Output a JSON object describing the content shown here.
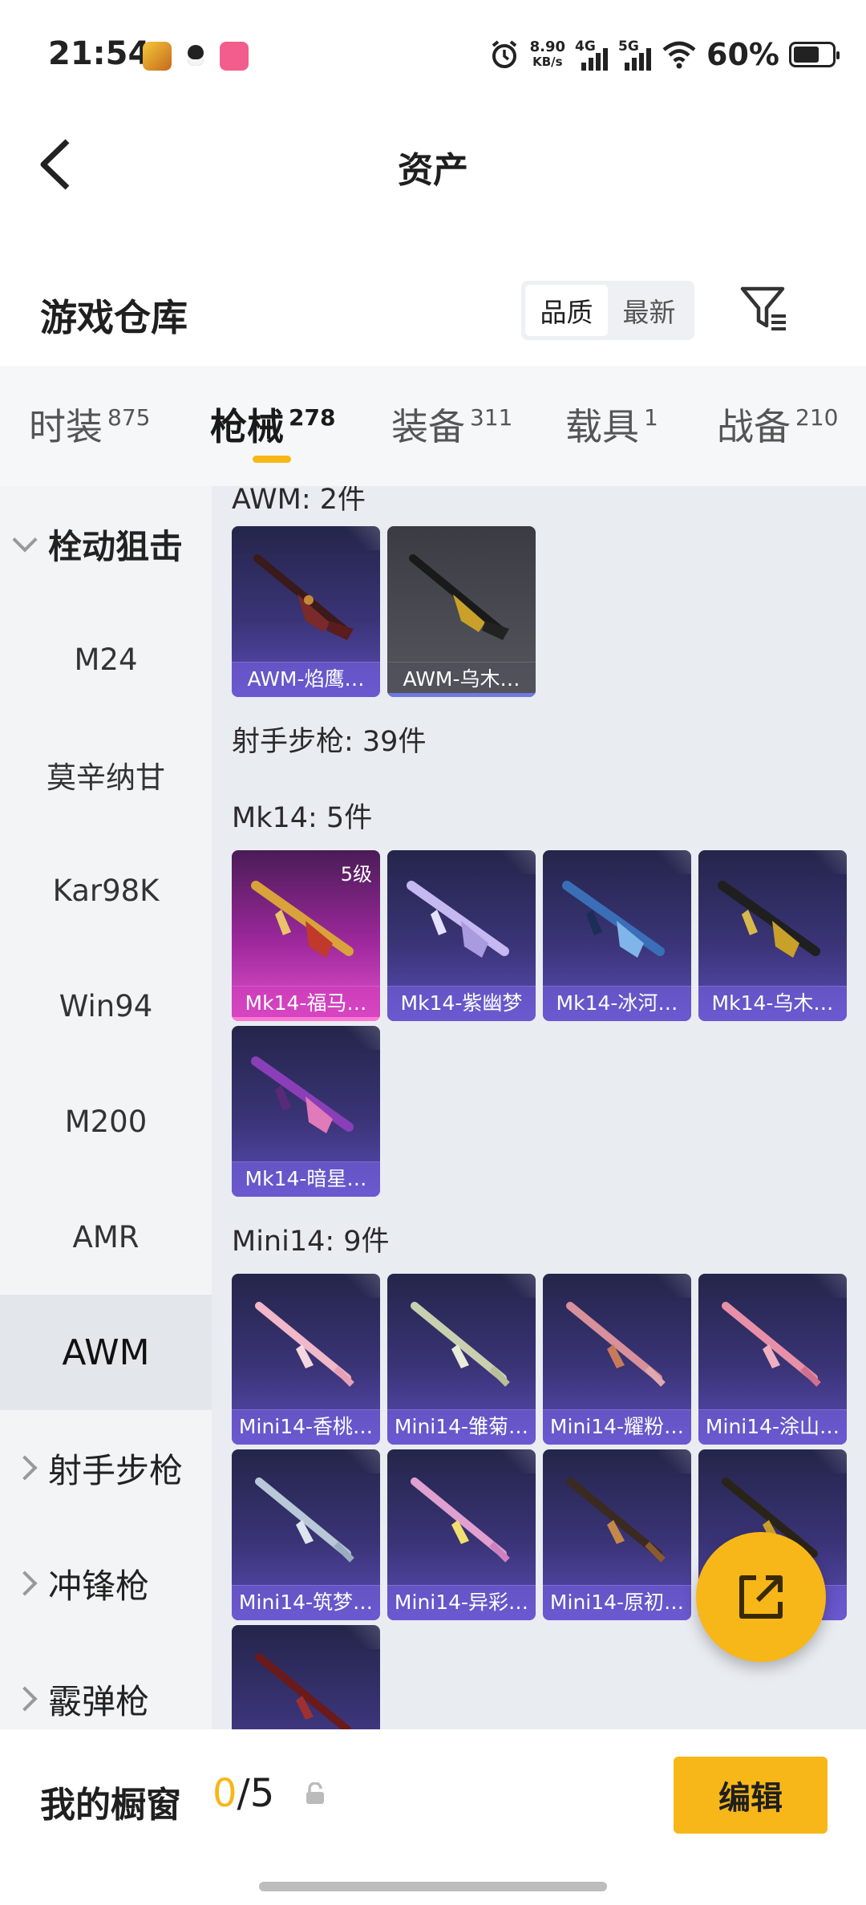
{
  "status": {
    "time": "21:54",
    "net_speed_value": "8.90",
    "net_speed_unit": "KB/s",
    "signal1_label": "4G",
    "signal2_label": "5G",
    "battery": "60%"
  },
  "header": {
    "title": "资产"
  },
  "warehouse": {
    "title": "游戏仓库",
    "sort": [
      "品质",
      "最新"
    ]
  },
  "tabs": [
    {
      "label": "时装",
      "count": "875"
    },
    {
      "label": "枪械",
      "count": "278"
    },
    {
      "label": "装备",
      "count": "311"
    },
    {
      "label": "载具",
      "count": "1"
    },
    {
      "label": "战备",
      "count": "210"
    }
  ],
  "sidebar": {
    "group_open": "栓动狙击",
    "items": [
      "M24",
      "莫辛纳甘",
      "Kar98K",
      "Win94",
      "M200",
      "AMR",
      "AWM"
    ],
    "groups_closed": [
      "射手步枪",
      "冲锋枪",
      "霰弹枪"
    ]
  },
  "main": {
    "awm_label": "AWM: 2件",
    "awm_cards": [
      "AWM-焰鹰…",
      "AWM-乌木…"
    ],
    "dmr_label": "射手步枪: 39件",
    "mk14_label": "Mk14: 5件",
    "mk14_level": "5级",
    "mk14_cards": [
      "Mk14-福马…",
      "Mk14-紫幽梦",
      "Mk14-冰河…",
      "Mk14-乌木…",
      "Mk14-暗星…"
    ],
    "mini14_label": "Mini14: 9件",
    "mini14_cards": [
      "Mini14-香桃…",
      "Mini14-雏菊…",
      "Mini14-耀粉…",
      "Mini14-涂山…",
      "Mini14-筑梦…",
      "Mini14-异彩…",
      "Mini14-原初…",
      "…"
    ]
  },
  "bottom": {
    "showcase_label": "我的橱窗",
    "showcase_current": "0",
    "showcase_total": "/5",
    "edit_label": "编辑"
  },
  "colors": {
    "accent": "#f7b718",
    "card_purple": "#3a3477",
    "card_pink": "#a0289e"
  }
}
